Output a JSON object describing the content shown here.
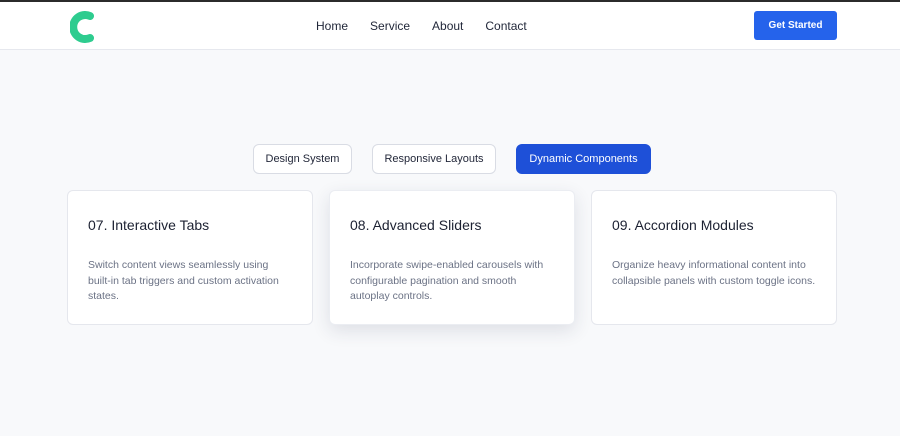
{
  "header": {
    "nav": [
      "Home",
      "Service",
      "About",
      "Contact"
    ],
    "cta_label": "Get Started"
  },
  "colors": {
    "brand": "#2ecc8f",
    "primary": "#2563eb",
    "active_tab": "#1e50d8"
  },
  "tabs": [
    {
      "label": "Design System",
      "active": false
    },
    {
      "label": "Responsive Layouts",
      "active": false
    },
    {
      "label": "Dynamic Components",
      "active": true
    }
  ],
  "cards": [
    {
      "title": "07. Interactive Tabs",
      "text": "Switch content views seamlessly using built-in tab triggers and custom activation states."
    },
    {
      "title": "08. Advanced Sliders",
      "text": "Incorporate swipe-enabled carousels with configurable pagination and smooth autoplay controls."
    },
    {
      "title": "09. Accordion Modules",
      "text": "Organize heavy informational content into collapsible panels with custom toggle icons."
    }
  ]
}
